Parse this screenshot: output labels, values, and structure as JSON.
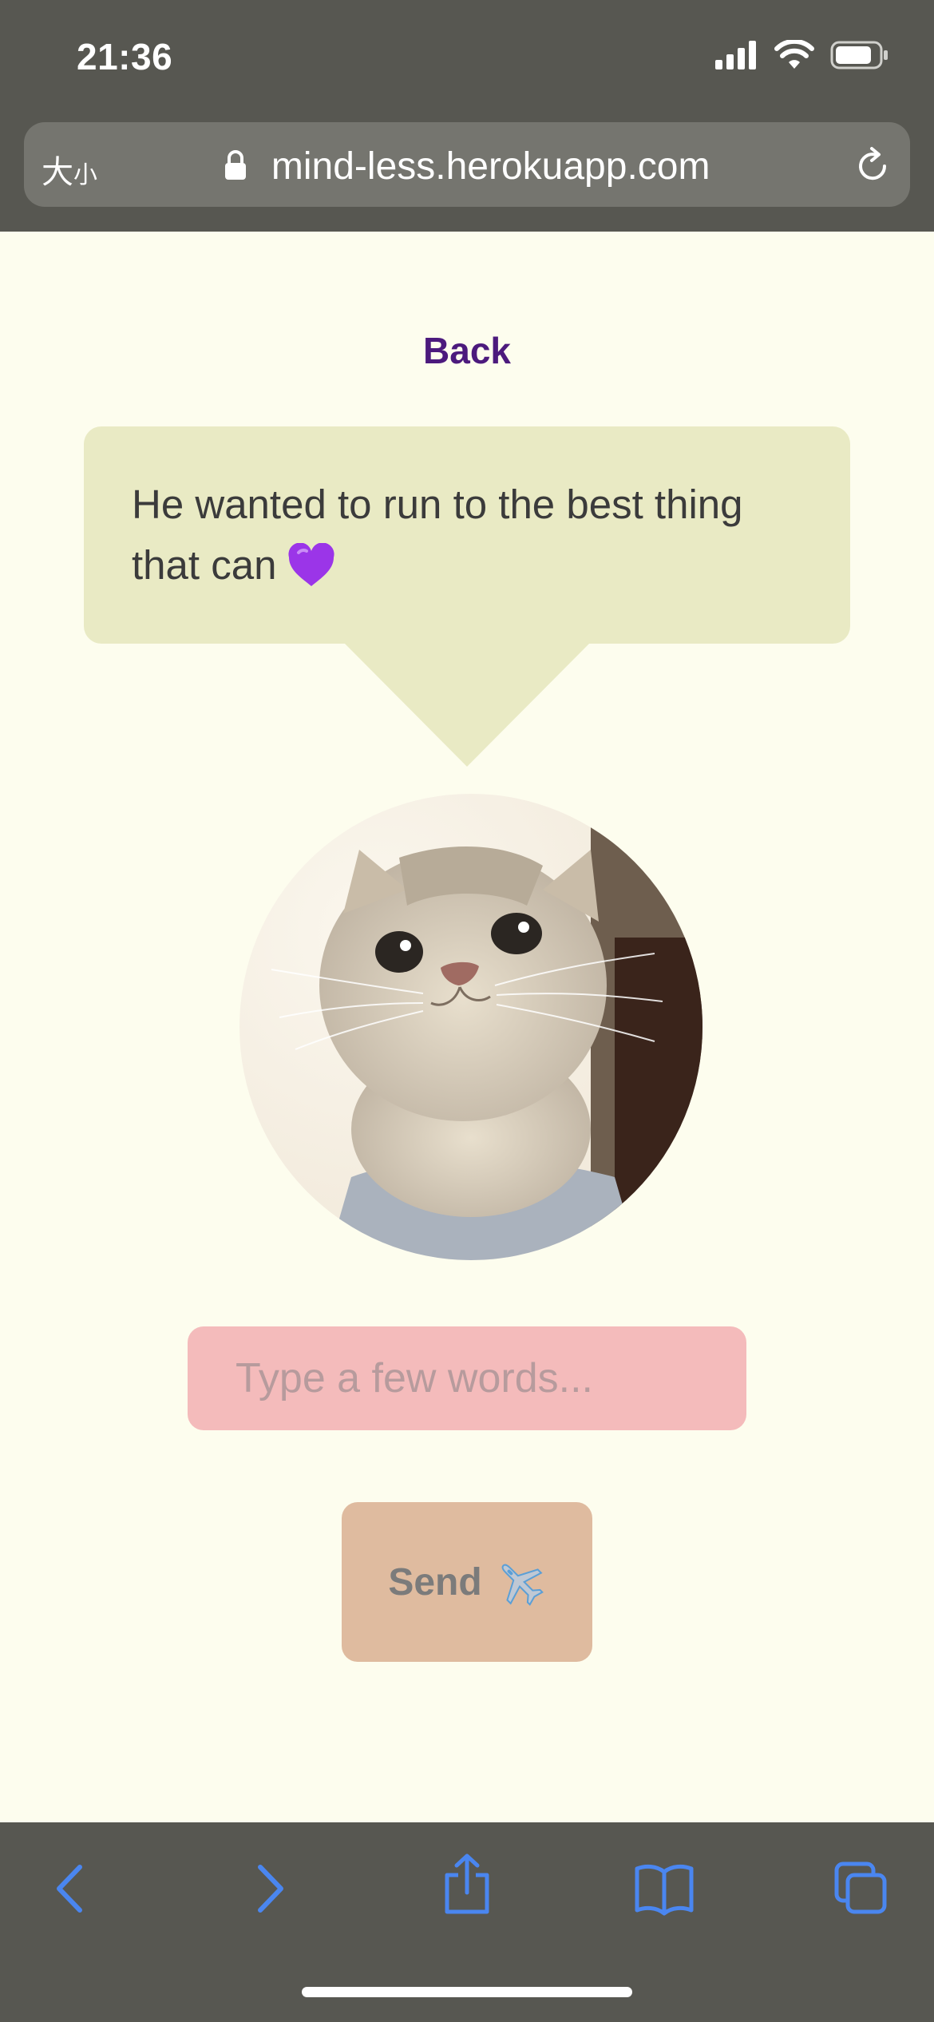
{
  "status_bar": {
    "time": "21:36"
  },
  "browser": {
    "text_size_large": "大",
    "text_size_small": "小",
    "url": "mind-less.herokuapp.com"
  },
  "page": {
    "back_label": "Back",
    "bubble_text": "He wanted to run to the best thing that can",
    "input_placeholder": "Type a few words...",
    "send_label": "Send"
  },
  "colors": {
    "chrome": "#575751",
    "page_background": "#fdfdee",
    "bubble": "#e9eac4",
    "input": "#f4bbbb",
    "button": "#dfbb9f",
    "link": "#4c1a7d",
    "toolbar_icons": "#4a86f0"
  },
  "icons": [
    "signal-icon",
    "wifi-icon",
    "battery-icon",
    "lock-icon",
    "reload-icon",
    "purple-heart-icon",
    "airplane-icon",
    "back-arrow-icon",
    "forward-arrow-icon",
    "share-icon",
    "bookmarks-icon",
    "tabs-icon"
  ]
}
